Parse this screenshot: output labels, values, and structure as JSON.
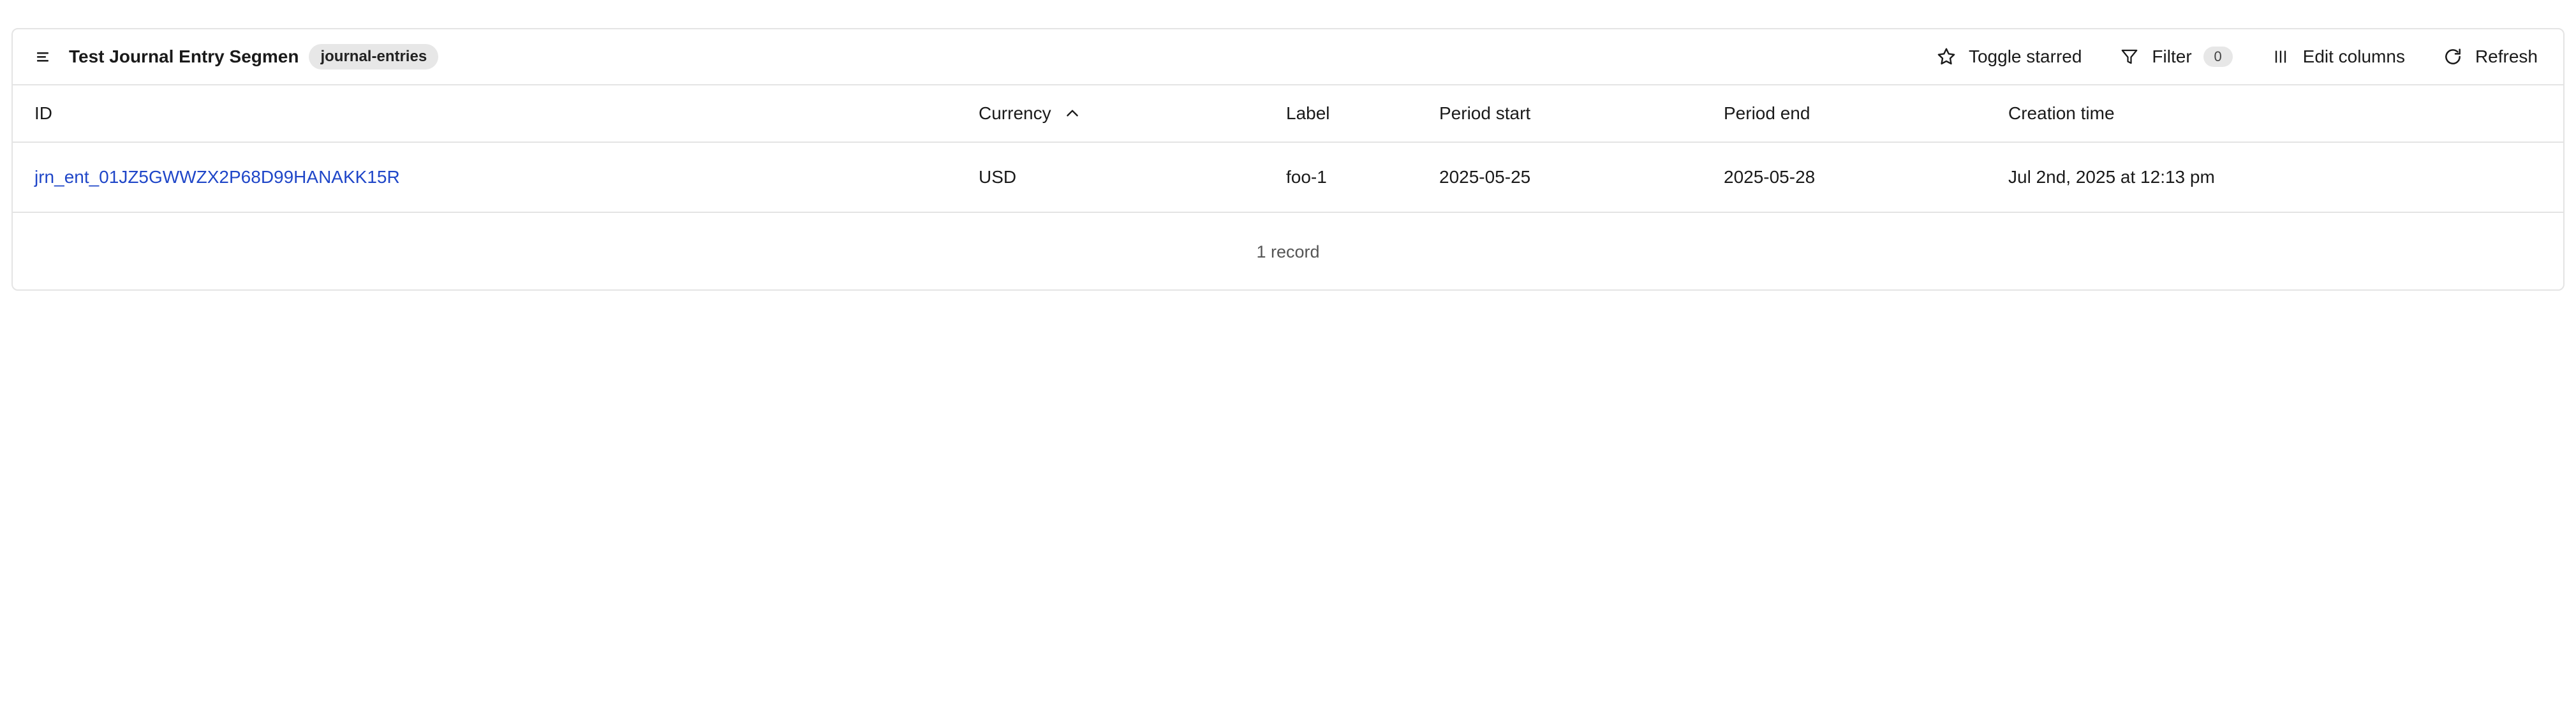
{
  "toolbar": {
    "title": "Test Journal Entry Segmen",
    "tag": "journal-entries",
    "buttons": {
      "toggle_starred": "Toggle starred",
      "filter": "Filter",
      "filter_count": "0",
      "edit_columns": "Edit columns",
      "refresh": "Refresh"
    },
    "icons": {
      "menu": "menu-icon",
      "star": "star-icon",
      "filter": "filter-icon",
      "columns": "columns-icon",
      "refresh": "refresh-icon"
    }
  },
  "table": {
    "columns": [
      "ID",
      "Currency",
      "Label",
      "Period start",
      "Period end",
      "Creation time"
    ],
    "sort": {
      "column": "Currency",
      "direction": "ascending"
    },
    "rows": [
      {
        "id": "jrn_ent_01JZ5GWWZX2P68D99HANAKK15R",
        "currency": "USD",
        "label": "foo-1",
        "period_start": "2025-05-25",
        "period_end": "2025-05-28",
        "creation_time": "Jul 2nd, 2025 at 12:13 pm"
      }
    ],
    "footer": "1 record"
  },
  "colors": {
    "link": "#1f46c8",
    "border": "#e4e4e4",
    "badge_bg": "#e7e7e7"
  }
}
